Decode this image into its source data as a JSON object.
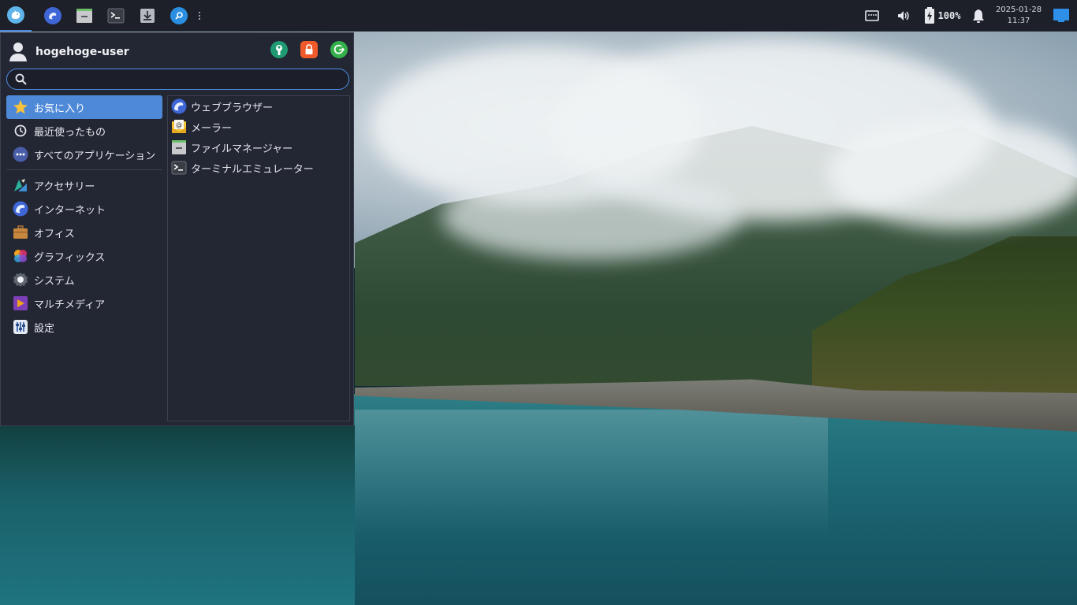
{
  "panel": {
    "pinned": [
      {
        "name": "web-browser-launcher",
        "icon": "browser-icon"
      },
      {
        "name": "file-manager-launcher",
        "icon": "file-manager-icon"
      },
      {
        "name": "terminal-launcher",
        "icon": "terminal-icon"
      },
      {
        "name": "downloads-launcher",
        "icon": "download-icon"
      },
      {
        "name": "app-finder-launcher",
        "icon": "search-icon"
      }
    ],
    "battery": "100%",
    "date": "2025-01-28",
    "time": "11:37"
  },
  "menu": {
    "username": "hogehoge-user",
    "search_placeholder": "",
    "categories": [
      {
        "label": "お気に入り",
        "icon": "star-icon",
        "active": true
      },
      {
        "label": "最近使ったもの",
        "icon": "clock-icon"
      },
      {
        "label": "すべてのアプリケーション",
        "icon": "all-apps-icon"
      },
      {
        "label": "アクセサリー",
        "icon": "accessories-icon"
      },
      {
        "label": "インターネット",
        "icon": "internet-icon"
      },
      {
        "label": "オフィス",
        "icon": "office-icon"
      },
      {
        "label": "グラフィックス",
        "icon": "graphics-icon"
      },
      {
        "label": "システム",
        "icon": "system-icon"
      },
      {
        "label": "マルチメディア",
        "icon": "multimedia-icon"
      },
      {
        "label": "設定",
        "icon": "settings-icon"
      }
    ],
    "favorites": [
      {
        "label": "ウェブブラウザー",
        "icon": "browser-icon"
      },
      {
        "label": "メーラー",
        "icon": "mail-icon"
      },
      {
        "label": "ファイルマネージャー",
        "icon": "file-manager-icon"
      },
      {
        "label": "ターミナルエミュレーター",
        "icon": "terminal-icon"
      }
    ]
  },
  "colors": {
    "panel_bg": "#1d2029",
    "menu_bg": "#232633",
    "accent": "#4e89d8"
  }
}
